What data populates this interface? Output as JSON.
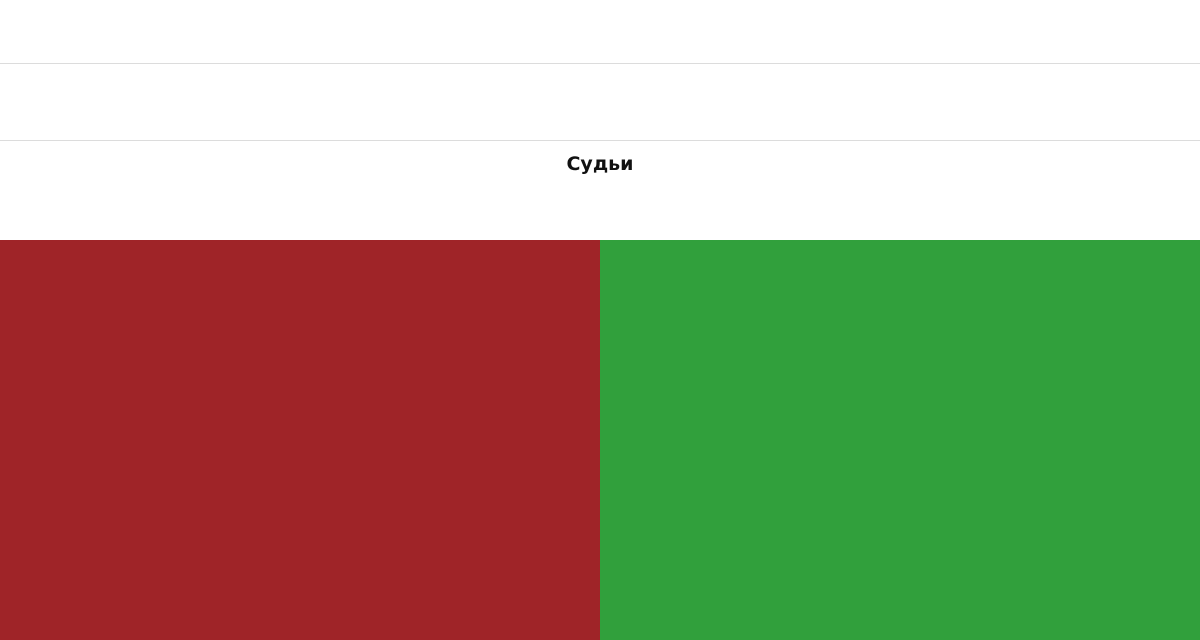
{
  "section": {
    "title": "Судьи"
  },
  "panels": {
    "left_color": "#9f2428",
    "right_color": "#31a03c"
  },
  "colors": {
    "divider": "#dcdcdc",
    "background": "#ffffff",
    "heading_text": "#111111"
  }
}
